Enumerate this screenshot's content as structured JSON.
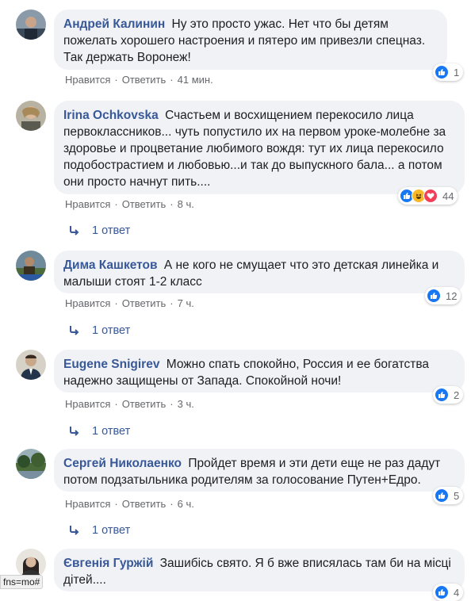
{
  "comments": [
    {
      "author": "Андрей Калинин",
      "text": "Ну это просто ужас. Нет что бы детям пожелать хорошего настроения и пятеро им привезли спецназ. Так держать Воронеж!",
      "like": "Нравится",
      "reply": "Ответить",
      "time": "41 мин.",
      "reaction_count": "1"
    },
    {
      "author": "Irina Ochkovska",
      "text": "Счастьем и восхищением перекосило лица первоклассников... чуть попустило их на первом уроке-молебне за здоровье и процветание любимого вождя: тут их лица перекосило подобострастием и любовью...и так до выпускного бала... а потом они просто начнут пить....",
      "like": "Нравится",
      "reply": "Ответить",
      "time": "8 ч.",
      "reaction_count": "44",
      "replies": "1 ответ"
    },
    {
      "author": "Дима Кашкетов",
      "text": "А не кого не смущает что это детская линейка и малыши стоят 1-2 класс",
      "like": "Нравится",
      "reply": "Ответить",
      "time": "7 ч.",
      "reaction_count": "12",
      "replies": "1 ответ"
    },
    {
      "author": "Eugene Snigirev",
      "text": "Можно спать спокойно, Россия и ее богатства надежно защищены от Запада. Спокойной ночи!",
      "like": "Нравится",
      "reply": "Ответить",
      "time": "3 ч.",
      "reaction_count": "2",
      "replies": "1 ответ"
    },
    {
      "author": "Сергей Николаенко",
      "text": "Пройдет время и эти дети еще не раз дадут потом подзатыльника родителям за голосование Путен+Едро.",
      "like": "Нравится",
      "reply": "Ответить",
      "time": "6 ч.",
      "reaction_count": "5",
      "replies": "1 ответ"
    },
    {
      "author": "Євгенія Гуржій",
      "text": "Зашибісь свято. Я б вже вписялась там би на місці дітей....",
      "reaction_count": "4"
    }
  ],
  "status_url": "fns=mo#",
  "colors": {
    "link": "#385898",
    "like_blue": "#1877f2",
    "bubble": "#f0f2f5",
    "meta": "#65676b"
  }
}
